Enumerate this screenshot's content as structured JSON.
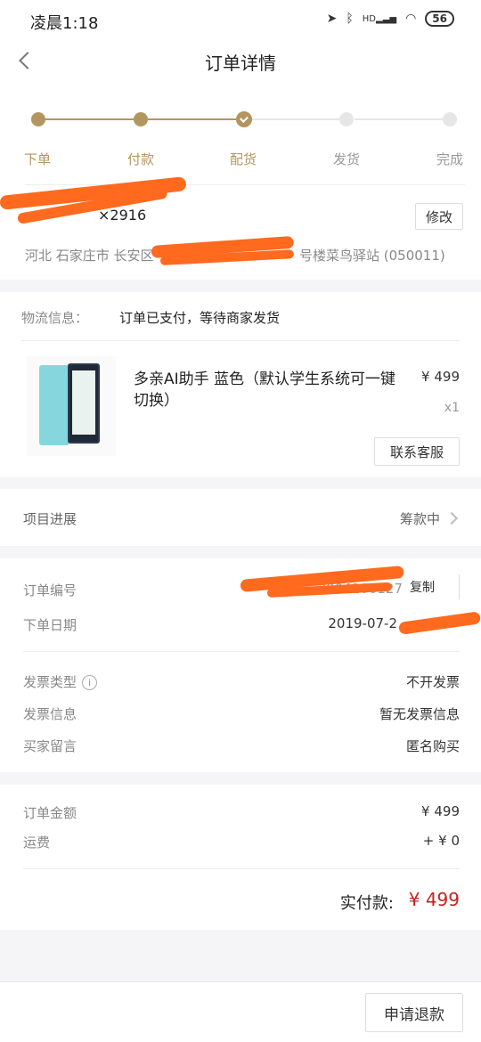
{
  "status_bar": {
    "time": "凌晨1:18",
    "battery": "56",
    "net_label": "HD"
  },
  "nav": {
    "title": "订单详情"
  },
  "steps": [
    {
      "label": "下单",
      "state": "done"
    },
    {
      "label": "付款",
      "state": "done"
    },
    {
      "label": "配货",
      "state": "current"
    },
    {
      "label": "发货",
      "state": "todo"
    },
    {
      "label": "完成",
      "state": "todo"
    }
  ],
  "address": {
    "name": "",
    "phone_tail": "2916",
    "modify_label": "修改",
    "region": "河北 石家庄市 长安区",
    "detail_tail": "号楼菜鸟驿站 (050011)"
  },
  "logistics": {
    "label": "物流信息：",
    "value": "订单已支付，等待商家发货"
  },
  "product": {
    "name": "多亲AI助手 蓝色（默认学生系统可一键切换）",
    "price": "¥ 499",
    "qty": "x1",
    "cs_label": "联系客服"
  },
  "progress": {
    "label": "项目进展",
    "value": "筹款中"
  },
  "order": {
    "number_label": "订单编号",
    "number_value": "3004200127",
    "copy_label": "复制",
    "date_label": "下单日期",
    "date_value": "2019-07-2",
    "invoice_type_label": "发票类型",
    "invoice_type_value": "不开发票",
    "invoice_info_label": "发票信息",
    "invoice_info_value": "暂无发票信息",
    "message_label": "买家留言",
    "message_value": "匿名购买"
  },
  "amount": {
    "order_label": "订单金额",
    "order_value": "¥ 499",
    "shipping_label": "运费",
    "shipping_value": "+ ¥ 0",
    "paid_label": "实付款:",
    "paid_value": "¥ 499"
  },
  "bottom": {
    "refund_label": "申请退款"
  },
  "colors": {
    "accent": "#b3955f",
    "price_red": "#c8201f",
    "redaction": "#ff6a1f"
  }
}
